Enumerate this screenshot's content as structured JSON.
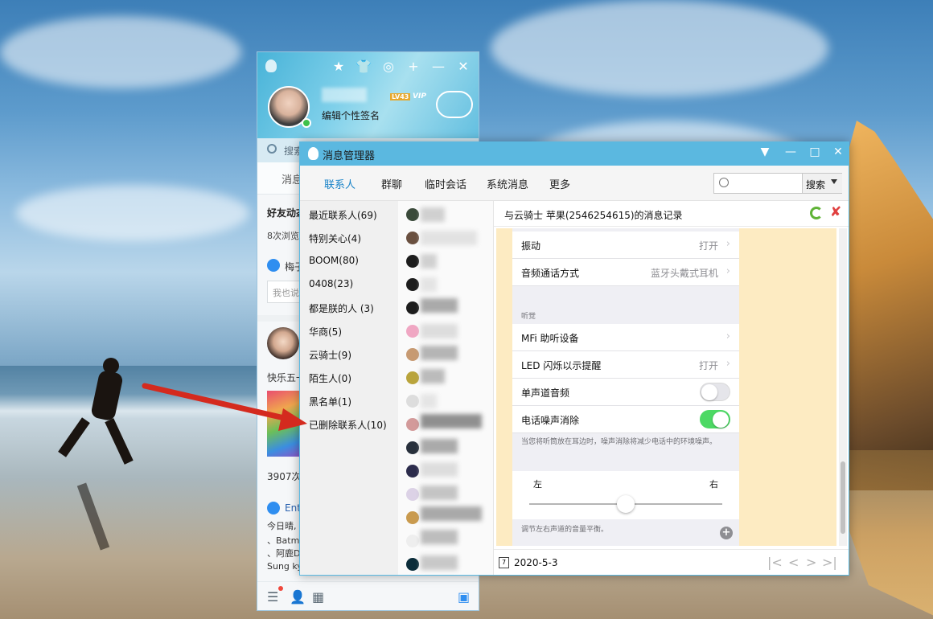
{
  "qq_main": {
    "signature": "编辑个性签名",
    "level_badge": "LV43",
    "vip_badge": "VIP",
    "search_placeholder": "搜索",
    "tab_label": "消息",
    "feed": {
      "line1": "好友动态",
      "line2": "8次浏览",
      "like_name": "梅子",
      "comment_placeholder": "我也说",
      "post_text": "快乐五一",
      "views": "3907次",
      "share_name": "Ent",
      "line_a": "今日晴,",
      "line_b": "、Batm",
      "line_c": "、阿鹿D",
      "line_d": "Sung ky"
    }
  },
  "message_manager": {
    "title": "消息管理器",
    "tabs": [
      {
        "label": "联系人",
        "active": true
      },
      {
        "label": "群聊",
        "active": false
      },
      {
        "label": "临时会话",
        "active": false
      },
      {
        "label": "系统消息",
        "active": false
      },
      {
        "label": "更多",
        "active": false
      }
    ],
    "search_button": "搜索",
    "groups": [
      "最近联系人(69)",
      "特别关心(4)",
      "BOOM(80)",
      "0408(23)",
      "都是朕的人 (3)",
      "华商(5)",
      "云骑士(9)",
      "陌生人(0)",
      "黑名单(1)",
      "已删除联系人(10)"
    ],
    "record_title": "与云骑士 苹果(2546254615)的消息记录",
    "date": "2020-5-3"
  },
  "ios_settings": {
    "rows": [
      {
        "label": "振动",
        "value": "打开"
      },
      {
        "label": "音频通话方式",
        "value": "蓝牙头戴式耳机"
      }
    ],
    "section_hearing": "听觉",
    "hearing_rows": [
      {
        "label": "MFi 助听设备",
        "value": ""
      },
      {
        "label": "LED 闪烁以示提醒",
        "value": "打开"
      }
    ],
    "mono_audio": {
      "label": "单声道音频",
      "on": false
    },
    "noise_cancel": {
      "label": "电话噪声消除",
      "on": true
    },
    "note": "当您将听筒放在耳边时，噪声消除将减少电话中的环境噪声。",
    "balance_left": "左",
    "balance_right": "右",
    "balance_value": 0.5,
    "balance_note": "调节左右声道的音量平衡。"
  },
  "colors": {
    "accent": "#5bb8e0",
    "active_tab": "#1a84c9",
    "arrow": "#d42a1e",
    "message_bg": "#fdebc2",
    "toggle_on": "#4cd964"
  }
}
